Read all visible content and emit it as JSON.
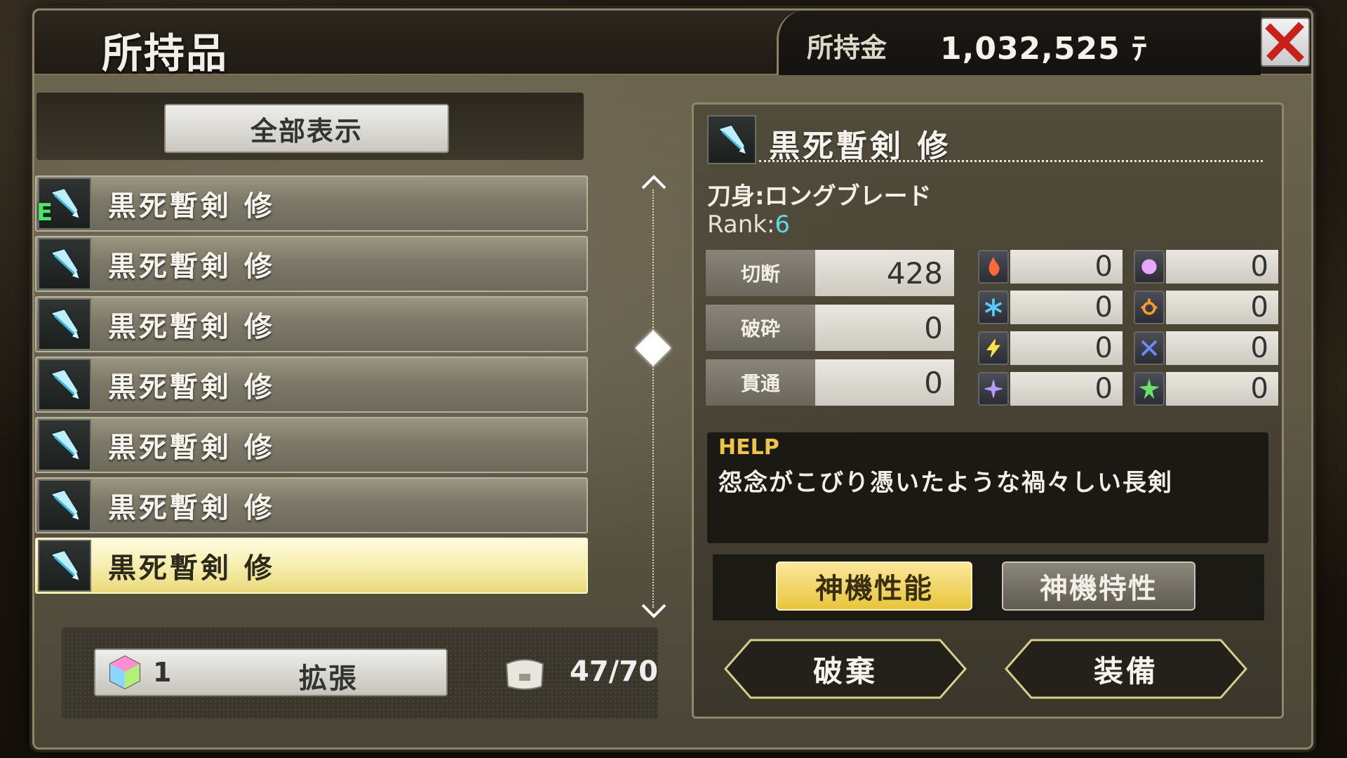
{
  "header": {
    "title": "所持品",
    "money_label": "所持金",
    "money_value": "1,032,525 ﾃ"
  },
  "filter": {
    "label": "全部表示"
  },
  "list": {
    "items": [
      {
        "name": "黒死暫剣 修",
        "badge": "E",
        "selected": false
      },
      {
        "name": "黒死暫剣 修",
        "badge": "",
        "selected": false
      },
      {
        "name": "黒死暫剣 修",
        "badge": "",
        "selected": false
      },
      {
        "name": "黒死暫剣 修",
        "badge": "",
        "selected": false
      },
      {
        "name": "黒死暫剣 修",
        "badge": "",
        "selected": false
      },
      {
        "name": "黒死暫剣 修",
        "badge": "",
        "selected": false
      },
      {
        "name": "黒死暫剣 修",
        "badge": "",
        "selected": true
      }
    ]
  },
  "footer": {
    "expand_count": "1",
    "expand_label": "拡張",
    "capacity": "47/70"
  },
  "detail": {
    "name": "黒死暫剣 修",
    "blade_type": "刀身:ロングブレード",
    "rank_label": "Rank:",
    "rank_value": "6",
    "stats": [
      {
        "label": "切断",
        "value": "428"
      },
      {
        "label": "破砕",
        "value": "0"
      },
      {
        "label": "貫通",
        "value": "0"
      }
    ],
    "elements": [
      {
        "icon": "fire-icon",
        "value": "0",
        "color": "#ff6a3a"
      },
      {
        "icon": "orb-icon",
        "value": "0",
        "color": "#e9a6ff"
      },
      {
        "icon": "ice-icon",
        "value": "0",
        "color": "#58c8ff"
      },
      {
        "icon": "sun-icon",
        "value": "0",
        "color": "#ff9a2a"
      },
      {
        "icon": "lightning-icon",
        "value": "0",
        "color": "#ffe14a"
      },
      {
        "icon": "cross-icon",
        "value": "0",
        "color": "#6a8bff"
      },
      {
        "icon": "star-icon",
        "value": "0",
        "color": "#b49bff"
      },
      {
        "icon": "leaf-star-icon",
        "value": "0",
        "color": "#6be06a"
      }
    ],
    "help_title": "HELP",
    "help_text": "怨念がこびり憑いたような禍々しい長剣",
    "tabs": [
      "神機性能",
      "神機特性"
    ],
    "actions": {
      "discard": "破棄",
      "equip": "装備"
    }
  }
}
